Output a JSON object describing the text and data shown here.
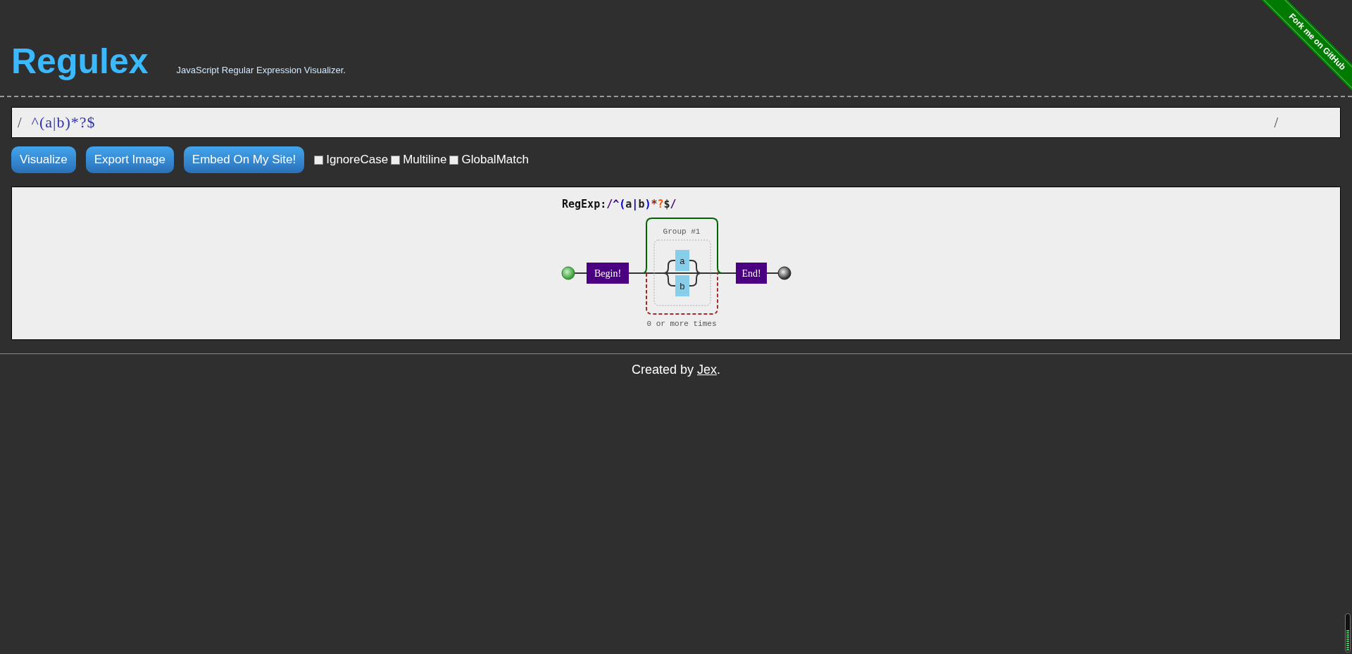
{
  "header": {
    "title": "Regulex",
    "subtitle": "JavaScript Regular Expression Visualizer."
  },
  "ribbon": {
    "label": "Fork me on GitHub"
  },
  "regex_input": {
    "open_slash": "/",
    "value": "^(a|b)*?$",
    "close_slash": "/"
  },
  "buttons": [
    "Visualize",
    "Export Image",
    "Embed On My Site!"
  ],
  "flags": [
    {
      "label": "IgnoreCase",
      "checked": false
    },
    {
      "label": "Multiline",
      "checked": false
    },
    {
      "label": "GlobalMatch",
      "checked": false
    }
  ],
  "diagram": {
    "regexp_label": "RegExp:",
    "tokens": [
      {
        "text": "/",
        "color": "#4b0082"
      },
      {
        "text": "^",
        "color": "#4b0082"
      },
      {
        "text": "(",
        "color": "#0000cc"
      },
      {
        "text": "a",
        "color": "#222222"
      },
      {
        "text": "|",
        "color": "#0000cc"
      },
      {
        "text": "b",
        "color": "#222222"
      },
      {
        "text": ")",
        "color": "#0000cc"
      },
      {
        "text": "*",
        "color": "#8b1a1a"
      },
      {
        "text": "?",
        "color": "#ff5500"
      },
      {
        "text": "$",
        "color": "#222222"
      },
      {
        "text": "/",
        "color": "#4b0082"
      }
    ],
    "begin": "Begin!",
    "end": "End!",
    "group_label": "Group #1",
    "branches": [
      "a",
      "b"
    ],
    "repeat_label": "0 or more times"
  },
  "footer": {
    "before": "Created by ",
    "link": "Jex",
    "after": "."
  }
}
